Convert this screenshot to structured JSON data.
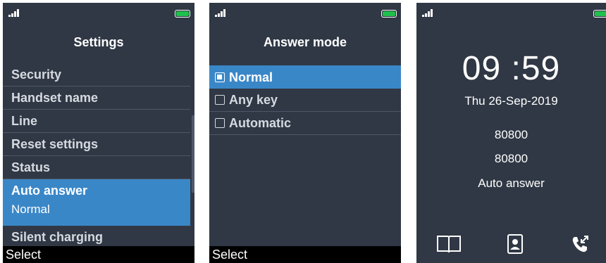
{
  "screens": {
    "settings": {
      "title": "Settings",
      "items": [
        {
          "label": "Security"
        },
        {
          "label": "Handset name"
        },
        {
          "label": "Line"
        },
        {
          "label": "Reset settings"
        },
        {
          "label": "Status"
        },
        {
          "label": "Auto answer",
          "value": "Normal",
          "selected": true
        },
        {
          "label": "Silent charging"
        }
      ],
      "softkey": "Select"
    },
    "answer_mode": {
      "title": "Answer mode",
      "options": [
        {
          "label": "Normal",
          "checked": true
        },
        {
          "label": "Any key",
          "checked": false
        },
        {
          "label": "Automatic",
          "checked": false
        }
      ],
      "softkey": "Select"
    },
    "idle": {
      "time": "09 :59",
      "date": "Thu 26-Sep-2019",
      "line1": "80800",
      "line2": "80800",
      "mode": "Auto answer",
      "icons": [
        "book-icon",
        "contact-icon",
        "call-log-icon"
      ]
    }
  },
  "colors": {
    "screen_bg": "#303845",
    "selection": "#3a87c8",
    "battery": "#1fc04b",
    "softkey_bg": "#000000"
  }
}
